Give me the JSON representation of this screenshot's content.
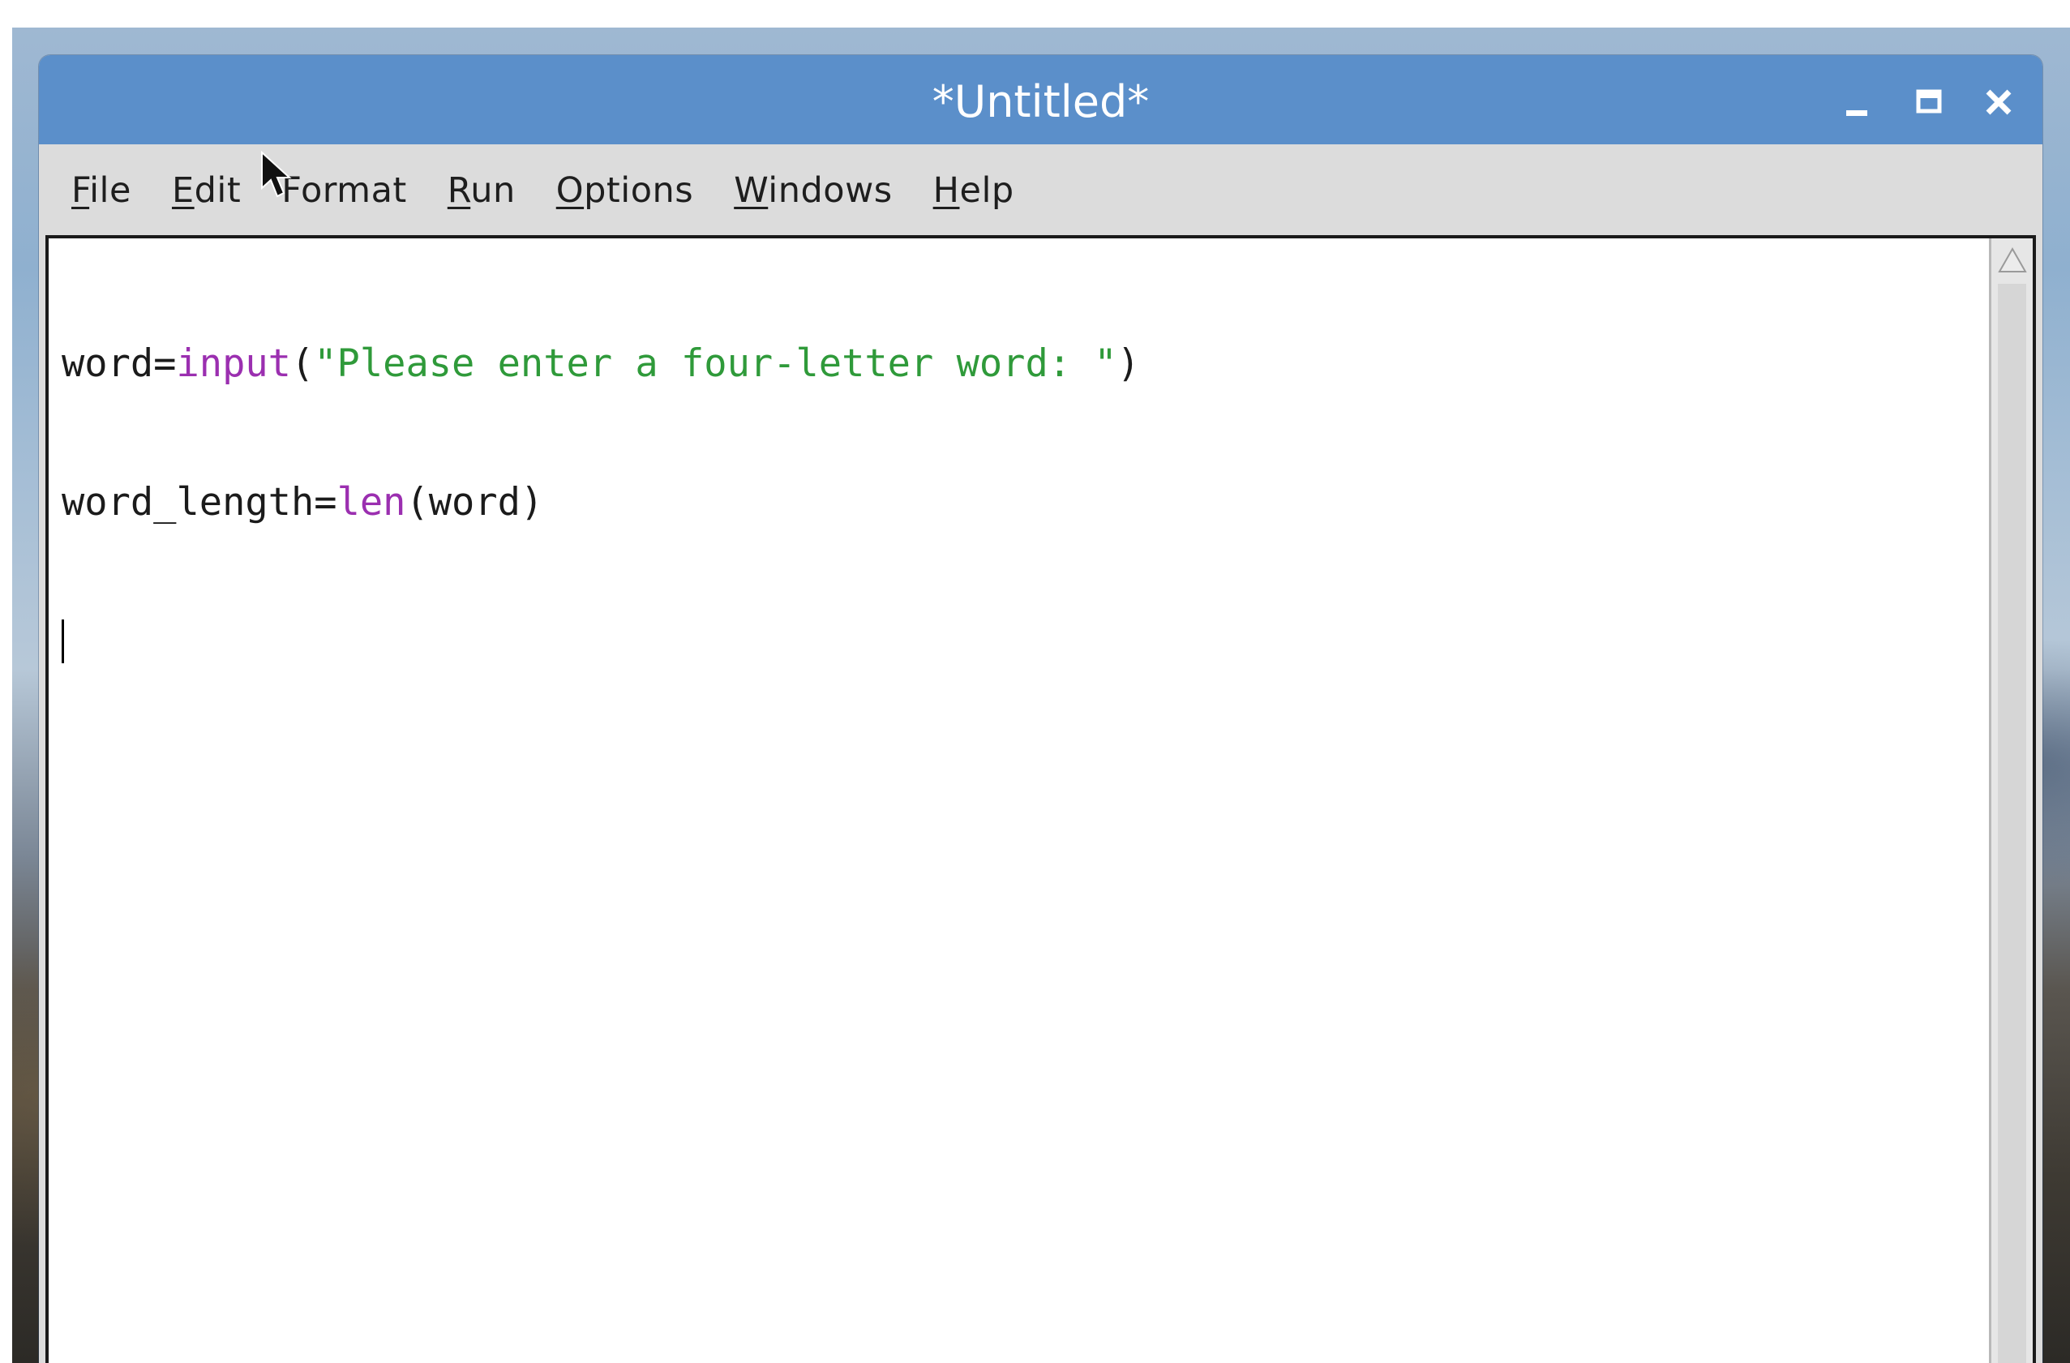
{
  "window": {
    "title": "*Untitled*",
    "controls": {
      "minimize_icon": "minimize-icon",
      "maximize_icon": "maximize-icon",
      "close_icon": "close-icon"
    }
  },
  "menubar": {
    "items": [
      {
        "label": "File",
        "underline": "F",
        "rest": "ile"
      },
      {
        "label": "Edit",
        "underline": "E",
        "rest": "dit"
      },
      {
        "label": "Format",
        "underline": "",
        "rest": "Format"
      },
      {
        "label": "Run",
        "underline": "R",
        "rest": "un"
      },
      {
        "label": "Options",
        "underline": "O",
        "rest": "ptions"
      },
      {
        "label": "Windows",
        "underline": "W",
        "rest": "indows"
      },
      {
        "label": "Help",
        "underline": "H",
        "rest": "elp"
      }
    ]
  },
  "editor": {
    "line1": {
      "a": "word=",
      "b": "input",
      "c": "(",
      "d": "\"Please enter a four-letter word: \"",
      "e": ")"
    },
    "line2": {
      "a": "word_length=",
      "b": "len",
      "c": "(word)"
    }
  },
  "colors": {
    "titlebar": "#5b8fca",
    "builtin": "#9b2fb0",
    "string": "#2f9a3a"
  }
}
